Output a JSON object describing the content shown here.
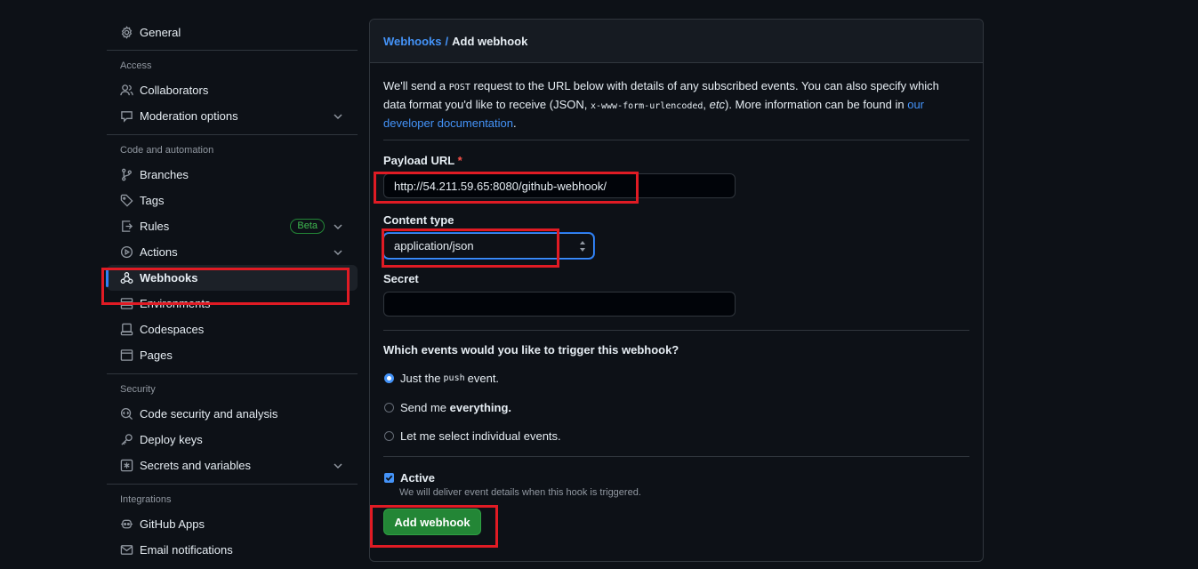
{
  "sidebar": {
    "general": "General",
    "groups": [
      {
        "heading": "Access",
        "items": [
          {
            "label": "Collaborators",
            "icon": "person-icon"
          },
          {
            "label": "Moderation options",
            "icon": "comment-icon",
            "expandable": true
          }
        ]
      },
      {
        "heading": "Code and automation",
        "items": [
          {
            "label": "Branches",
            "icon": "branch-icon"
          },
          {
            "label": "Tags",
            "icon": "tag-icon"
          },
          {
            "label": "Rules",
            "icon": "rules-icon",
            "badge": "Beta",
            "expandable": true
          },
          {
            "label": "Actions",
            "icon": "play-icon",
            "expandable": true
          },
          {
            "label": "Webhooks",
            "icon": "webhook-icon",
            "active": true
          },
          {
            "label": "Environments",
            "icon": "server-icon"
          },
          {
            "label": "Codespaces",
            "icon": "codespaces-icon"
          },
          {
            "label": "Pages",
            "icon": "browser-icon"
          }
        ]
      },
      {
        "heading": "Security",
        "items": [
          {
            "label": "Code security and analysis",
            "icon": "codescan-icon"
          },
          {
            "label": "Deploy keys",
            "icon": "key-icon"
          },
          {
            "label": "Secrets and variables",
            "icon": "asterisk-icon",
            "expandable": true
          }
        ]
      },
      {
        "heading": "Integrations",
        "items": [
          {
            "label": "GitHub Apps",
            "icon": "apps-icon"
          },
          {
            "label": "Email notifications",
            "icon": "mail-icon"
          }
        ]
      }
    ]
  },
  "breadcrumb": {
    "parent": "Webhooks",
    "separator": "/",
    "current": "Add webhook"
  },
  "intro": {
    "p1": "We'll send a ",
    "code1": "POST",
    "p2": " request to the URL below with details of any subscribed events. You can also specify which data format you'd like to receive (JSON, ",
    "code2": "x-www-form-urlencoded",
    "p3": ", ",
    "etc": "etc",
    "p4": "). More information can be found in ",
    "link": "our developer documentation",
    "p5": "."
  },
  "form": {
    "payload_label": "Payload URL",
    "required_mark": "*",
    "payload_value": "http://54.211.59.65:8080/github-webhook/",
    "content_type_label": "Content type",
    "content_type_value": "application/json",
    "secret_label": "Secret",
    "secret_value": "",
    "events_question": "Which events would you like to trigger this webhook?",
    "event_push_pre": "Just the",
    "event_push_code": "push",
    "event_push_post": "event.",
    "event_all_pre": "Send me",
    "event_all_bold": "everything.",
    "event_select": "Let me select individual events.",
    "active_label": "Active",
    "active_help": "We will deliver event details when this hook is triggered.",
    "submit_label": "Add webhook"
  },
  "colors": {
    "accent": "#4493f8",
    "button": "#238636",
    "highlight": "#e01b24",
    "background": "#0d1117"
  }
}
